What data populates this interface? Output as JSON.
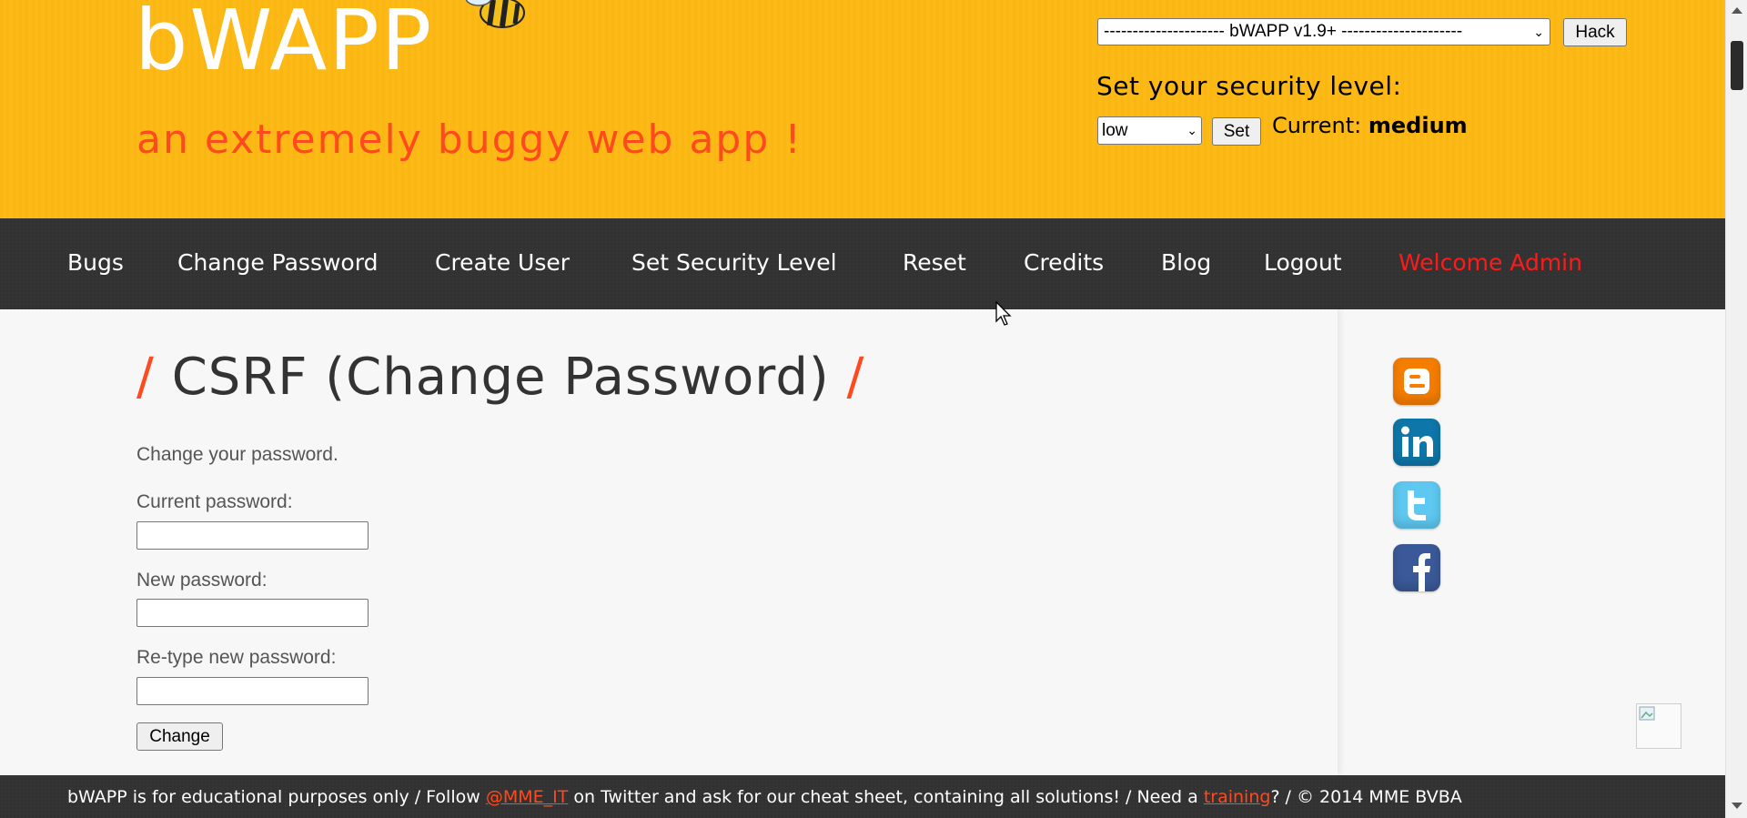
{
  "header": {
    "logo": "bWAPP",
    "tagline": "an extremely buggy web app !",
    "bug_select_value": "--------------------- bWAPP v1.9+ ---------------------",
    "hack_label": "Hack",
    "security_label": "Set your security level:",
    "level_select_value": "low",
    "set_label": "Set",
    "current_prefix": "Current:",
    "current_value": "medium"
  },
  "nav": {
    "items": [
      {
        "label": "Bugs"
      },
      {
        "label": "Change Password"
      },
      {
        "label": "Create User"
      },
      {
        "label": "Set Security Level"
      },
      {
        "label": "Reset"
      },
      {
        "label": "Credits"
      },
      {
        "label": "Blog"
      },
      {
        "label": "Logout"
      },
      {
        "label": "Welcome Admin"
      }
    ]
  },
  "main": {
    "title": "CSRF (Change Password)",
    "title_slash": "/",
    "intro": "Change your password.",
    "current_password_label": "Current password:",
    "new_password_label": "New password:",
    "retype_password_label": "Re-type new password:",
    "change_label": "Change"
  },
  "social": {
    "icons": [
      "blogger-icon",
      "linkedin-icon",
      "twitter-icon",
      "facebook-icon"
    ]
  },
  "footer": {
    "part1": "bWAPP is for educational purposes only / Follow ",
    "link1": "@MME_IT",
    "part2": " on Twitter and ask for our cheat sheet, containing all solutions! / Need a ",
    "link2": "training",
    "part3": "? / © 2014 MME BVBA"
  },
  "colors": {
    "header_bg": "#fdb913",
    "accent": "#ff4a1f",
    "nav_bg": "#323232",
    "welcome": "#ff1a1a"
  }
}
